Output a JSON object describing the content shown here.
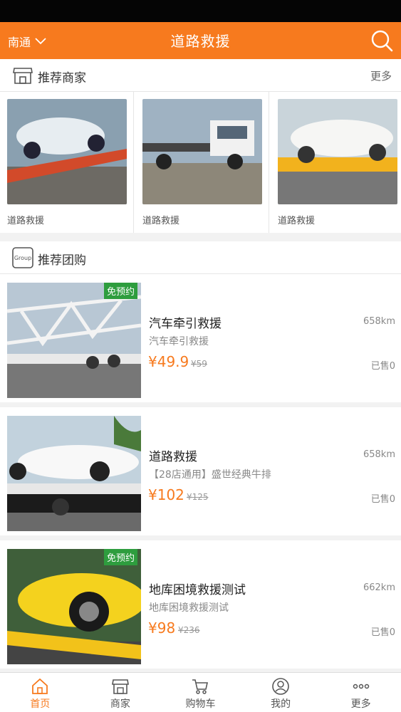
{
  "header": {
    "city": "南通",
    "title": "道路救援"
  },
  "shops_section": {
    "title": "推荐商家",
    "more": "更多"
  },
  "shops": [
    {
      "name": "道路救援"
    },
    {
      "name": "道路救援"
    },
    {
      "name": "道路救援"
    }
  ],
  "deals_section": {
    "title": "推荐团购",
    "icon_text": "Group"
  },
  "deals": [
    {
      "badge": "免预约",
      "name": "汽车牵引救援",
      "desc": "汽车牵引救援",
      "price": "¥49.9",
      "orig": "¥59",
      "distance": "658km",
      "sold": "已售0"
    },
    {
      "badge": "",
      "name": "道路救援",
      "desc": "【28店通用】盛世经典牛排",
      "price": "¥102",
      "orig": "¥125",
      "distance": "658km",
      "sold": "已售0"
    },
    {
      "badge": "免预约",
      "name": "地库困境救援测试",
      "desc": "地库困境救援测试",
      "price": "¥98",
      "orig": "¥236",
      "distance": "662km",
      "sold": "已售0"
    }
  ],
  "tabs": [
    {
      "label": "首页",
      "icon": "home-icon",
      "active": true
    },
    {
      "label": "商家",
      "icon": "store-icon",
      "active": false
    },
    {
      "label": "购物车",
      "icon": "cart-icon",
      "active": false
    },
    {
      "label": "我的",
      "icon": "user-icon",
      "active": false
    },
    {
      "label": "更多",
      "icon": "more-icon",
      "active": false
    }
  ],
  "colors": {
    "accent": "#f77a1e",
    "badge": "#2e9d3e"
  }
}
